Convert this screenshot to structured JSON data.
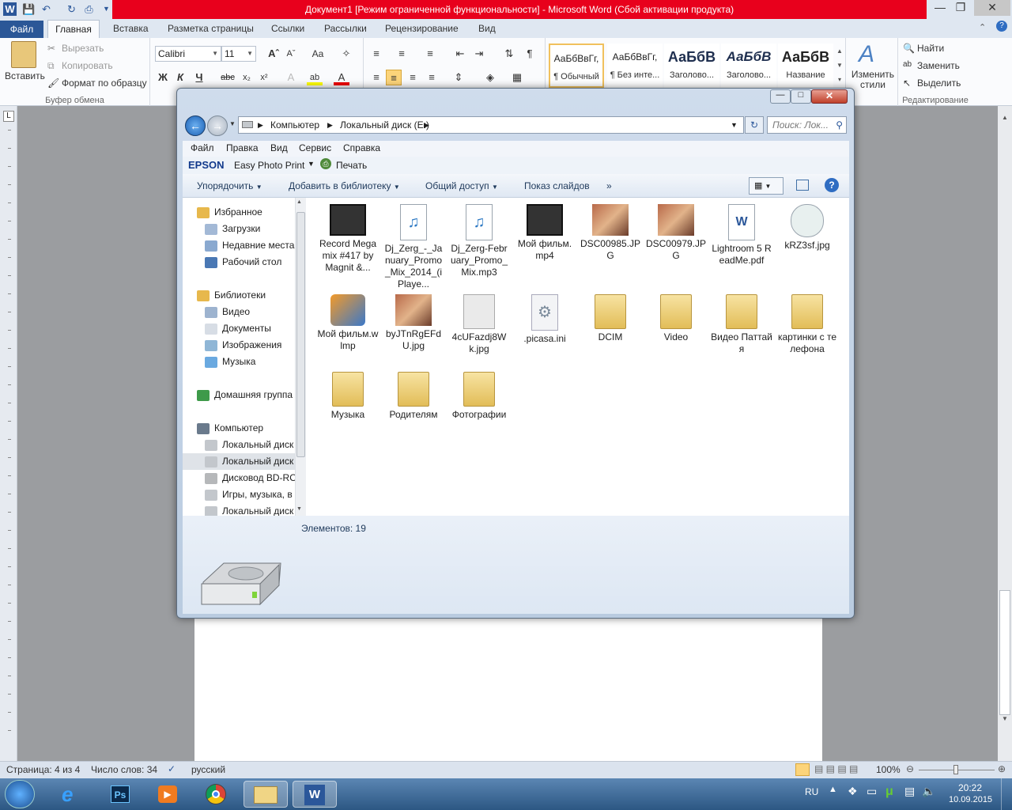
{
  "word": {
    "title": "Документ1 [Режим ограниченной функциональности]  -  Microsoft Word (Сбой активации продукта)",
    "tabs": [
      "Файл",
      "Главная",
      "Вставка",
      "Разметка страницы",
      "Ссылки",
      "Рассылки",
      "Рецензирование",
      "Вид"
    ],
    "clipboard": {
      "paste": "Вставить",
      "cut": "Вырезать",
      "copy": "Копировать",
      "format_painter": "Формат по образцу",
      "label": "Буфер обмена"
    },
    "font": {
      "name": "Calibri",
      "size": "11"
    },
    "styles": [
      {
        "preview": "АаБбВвГг,",
        "name": "¶ Обычный"
      },
      {
        "preview": "АаБбВвГг,",
        "name": "¶ Без инте..."
      },
      {
        "preview": "АаБбВ",
        "name": "Заголово..."
      },
      {
        "preview": "АаБбВ",
        "name": "Заголово..."
      },
      {
        "preview": "АаБбВ",
        "name": "Название"
      }
    ],
    "change_styles": "Изменить стили",
    "editing": {
      "find": "Найти",
      "replace": "Заменить",
      "select": "Выделить",
      "label": "Редактирование"
    },
    "status": {
      "page": "Страница: 4 из 4",
      "words": "Число слов: 34",
      "lang": "русский",
      "zoom": "100%"
    }
  },
  "explorer": {
    "breadcrumb": [
      "Компьютер",
      "Локальный диск (E:)"
    ],
    "search_placeholder": "Поиск: Лок...",
    "menu": [
      "Файл",
      "Правка",
      "Вид",
      "Сервис",
      "Справка"
    ],
    "epson": {
      "brand": "EPSON",
      "app": "Easy Photo Print",
      "print": "Печать"
    },
    "commands": [
      "Упорядочить",
      "Добавить в библиотеку",
      "Общий доступ",
      "Показ слайдов"
    ],
    "nav": [
      {
        "label": "Избранное",
        "indent": 0,
        "gap": false
      },
      {
        "label": "Загрузки",
        "indent": 1,
        "gap": false
      },
      {
        "label": "Недавние места",
        "indent": 1,
        "gap": false
      },
      {
        "label": "Рабочий стол",
        "indent": 1,
        "gap": false
      },
      {
        "label": "Библиотеки",
        "indent": 0,
        "gap": true
      },
      {
        "label": "Видео",
        "indent": 1,
        "gap": false
      },
      {
        "label": "Документы",
        "indent": 1,
        "gap": false
      },
      {
        "label": "Изображения",
        "indent": 1,
        "gap": false
      },
      {
        "label": "Музыка",
        "indent": 1,
        "gap": false
      },
      {
        "label": "Домашняя группа",
        "indent": 0,
        "gap": true
      },
      {
        "label": "Компьютер",
        "indent": 0,
        "gap": true
      },
      {
        "label": "Локальный диск",
        "indent": 1,
        "gap": false
      },
      {
        "label": "Локальный диск",
        "indent": 1,
        "gap": false,
        "selected": true
      },
      {
        "label": "Дисковод BD-RO",
        "indent": 1,
        "gap": false
      },
      {
        "label": "Игры, музыка, в",
        "indent": 1,
        "gap": false
      },
      {
        "label": "Локальный диск",
        "indent": 1,
        "gap": false
      }
    ],
    "items": [
      {
        "label": "Record Megamix #417 by Magnit &...",
        "kind": "video"
      },
      {
        "label": "Dj_Zerg_-_January_Promo_Mix_2014_(iPlaye...",
        "kind": "mp3"
      },
      {
        "label": "Dj_Zerg-February_Promo_Mix.mp3",
        "kind": "mp3"
      },
      {
        "label": "Мой фильм.mp4",
        "kind": "video"
      },
      {
        "label": "DSC00985.JPG",
        "kind": "photo"
      },
      {
        "label": "DSC00979.JPG",
        "kind": "photo"
      },
      {
        "label": "Lightroom 5 ReadMe.pdf",
        "kind": "doc"
      },
      {
        "label": "kRZ3sf.jpg",
        "kind": "image"
      },
      {
        "label": "Мой фильм.wlmp",
        "kind": "movie"
      },
      {
        "label": "byJTnRgEFdU.jpg",
        "kind": "photo"
      },
      {
        "label": "4cUFazdj8Wk.jpg",
        "kind": "page"
      },
      {
        "label": ".picasa.ini",
        "kind": "ini"
      },
      {
        "label": "DCIM",
        "kind": "folder"
      },
      {
        "label": "Video",
        "kind": "folder"
      },
      {
        "label": "Видео Паттайя",
        "kind": "folder"
      },
      {
        "label": "картинки с телефона",
        "kind": "folder"
      },
      {
        "label": "Музыка",
        "kind": "folder"
      },
      {
        "label": "Родителям",
        "kind": "folder"
      },
      {
        "label": "Фотографии",
        "kind": "folder"
      }
    ],
    "count": "Элементов: 19"
  },
  "tray": {
    "lang": "RU",
    "time": "20:22",
    "date": "10.09.2015"
  }
}
